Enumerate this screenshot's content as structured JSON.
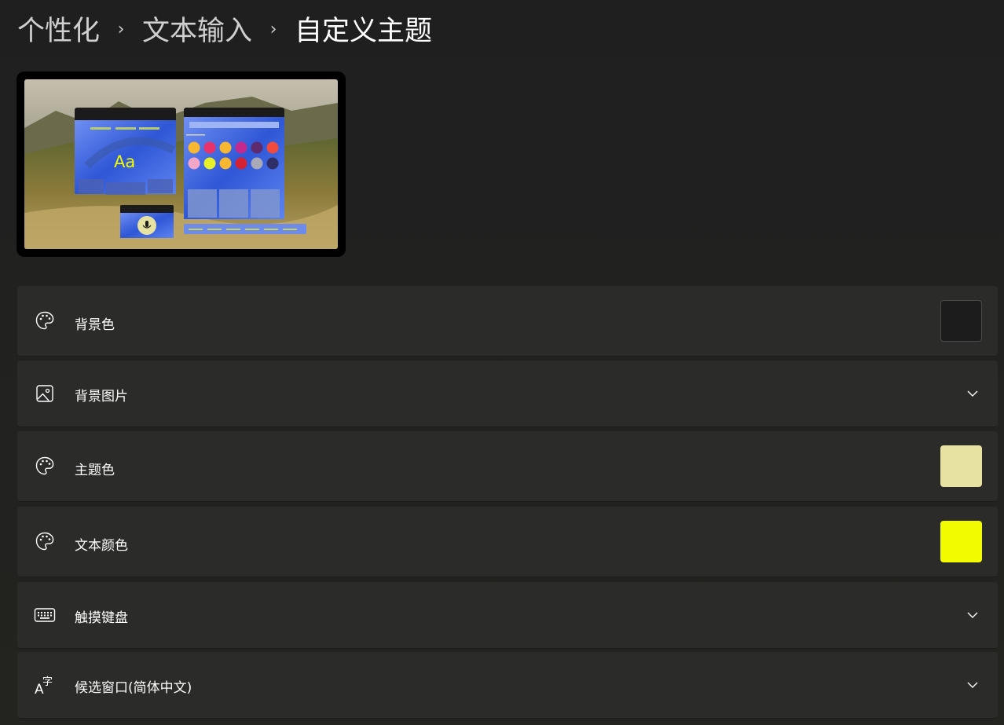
{
  "breadcrumb": {
    "items": [
      "个性化",
      "文本输入",
      "自定义主题"
    ],
    "separator": "›"
  },
  "preview": {
    "sample_text": "Aa",
    "accent": "#e7e2a2",
    "text_color": "#f2fb00",
    "palette_row1": [
      "#f7b731",
      "#e8336a",
      "#f7b731",
      "#c42a8c",
      "#5e2b6f",
      "#f24b3d"
    ],
    "palette_row2": [
      "#f3a7c8",
      "#e6ef2a",
      "#f7b731",
      "#d42134",
      "#a9a9b8",
      "#2f2e66"
    ],
    "icons": [
      "microphone-icon"
    ]
  },
  "settings": {
    "background_color": {
      "label": "背景色",
      "icon": "palette-icon",
      "swatch": "#1c1c1c"
    },
    "background_image": {
      "label": "背景图片",
      "icon": "image-icon",
      "control": "chevron-down-icon"
    },
    "theme_color": {
      "label": "主题色",
      "icon": "palette-icon",
      "swatch": "#e7e2a2"
    },
    "text_color": {
      "label": "文本颜色",
      "icon": "palette-icon",
      "swatch": "#f2fb00"
    },
    "touch_keyboard": {
      "label": "触摸键盘",
      "icon": "keyboard-icon",
      "control": "chevron-down-icon"
    },
    "candidate_window": {
      "label": "候选窗口(简体中文)",
      "icon": "language-icon",
      "control": "chevron-down-icon"
    }
  }
}
